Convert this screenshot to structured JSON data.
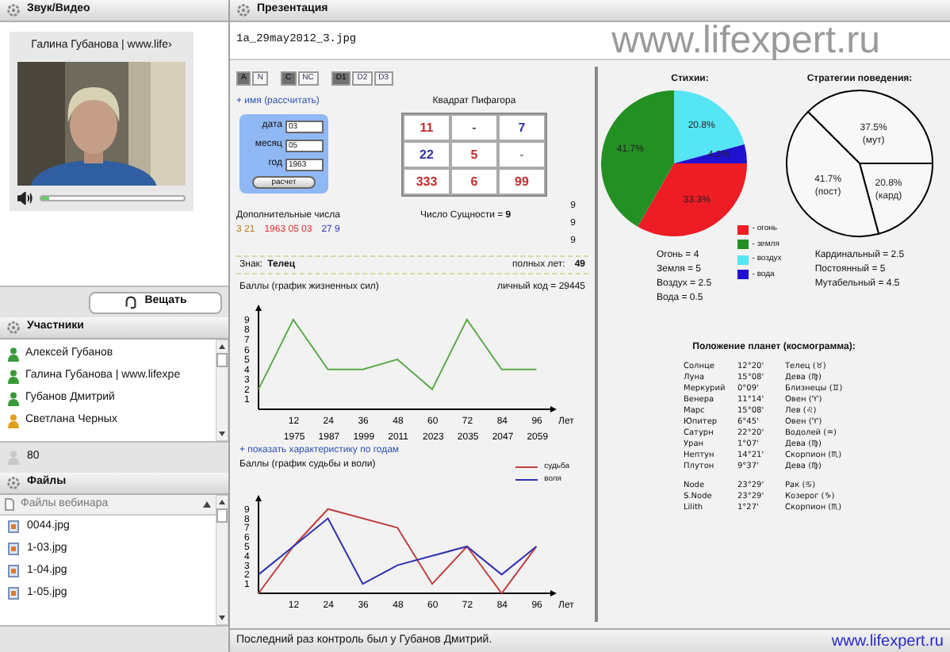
{
  "audio_video": {
    "title": "Звук/Видео",
    "speaker": "Галина Губанова | www.life›",
    "volume": {
      "level": 0.06
    },
    "broadcast_button": "Вещать"
  },
  "participants": {
    "title": "Участники",
    "items": [
      {
        "name": "Алексей Губанов",
        "color": "#3a9a3a"
      },
      {
        "name": "Галина Губанова | www.lifexpe",
        "color": "#3a9a3a"
      },
      {
        "name": "Губанов Дмитрий",
        "color": "#3a9a3a"
      },
      {
        "name": "Светлана Черных",
        "color": "#e0a020"
      }
    ],
    "count": "80"
  },
  "files": {
    "title": "Файлы",
    "column": "Файлы вебинара",
    "items": [
      "0044.jpg",
      "1-03.jpg",
      "1-04.jpg",
      "1-05.jpg"
    ]
  },
  "presentation": {
    "title": "Презентация",
    "filename": "1a_29may2012_3.jpg",
    "site_banner": "www.lifexpert.ru",
    "mode_groups": [
      [
        {
          "label": "A",
          "selected": true
        },
        {
          "label": "N",
          "selected": false
        }
      ],
      [
        {
          "label": "C",
          "selected": true
        },
        {
          "label": "NC",
          "selected": false
        }
      ],
      [
        {
          "label": "D1",
          "selected": true
        },
        {
          "label": "D2",
          "selected": false
        },
        {
          "label": "D3",
          "selected": false
        }
      ]
    ],
    "name_link": "+ имя (рассчитать)",
    "form": {
      "fields": [
        {
          "label": "дата",
          "value": "03"
        },
        {
          "label": "месяц",
          "value": "05"
        },
        {
          "label": "год",
          "value": "1963"
        }
      ],
      "button": "расчет"
    },
    "square": {
      "title": "Квадрат Пифагора",
      "cells": [
        {
          "text": "11",
          "color": "#c03030"
        },
        {
          "text": "-",
          "color": "#555555"
        },
        {
          "text": "7",
          "color": "#3030a0"
        },
        {
          "text": "22",
          "color": "#3030a0"
        },
        {
          "text": "5",
          "color": "#c03030"
        },
        {
          "text": "-",
          "color": "#888888"
        },
        {
          "text": "333",
          "color": "#c03030"
        },
        {
          "text": "6",
          "color": "#c03030"
        },
        {
          "text": "99",
          "color": "#c03030"
        }
      ]
    },
    "side_numbers": [
      "9",
      "9",
      "9"
    ],
    "extra": {
      "title": "Дополнительные числа",
      "numbers": [
        {
          "text": "3 21",
          "color": "#b08020"
        },
        {
          "text": "1963 05 03",
          "color": "#e03030"
        },
        {
          "text": "27 9",
          "color": "#3030c0"
        }
      ]
    },
    "essence": "Число Сущности = **9**",
    "sign_label": "Знак:",
    "sign": "Телец",
    "age_label": "полных лет:",
    "age": "49",
    "life_chart": {
      "title": "Баллы (график жизненных сил)",
      "code": "личный код = 29445",
      "years": [
        "1975",
        "1987",
        "1999",
        "2011",
        "2023",
        "2035",
        "2047",
        "2059"
      ],
      "chart_data": {
        "type": "line",
        "xlabel": "Лет",
        "x": [
          0,
          12,
          24,
          36,
          48,
          60,
          72,
          84,
          96
        ],
        "series": [
          {
            "color": "#5aaa4a",
            "values": [
              2,
              9,
              4,
              4,
              5,
              2,
              9,
              4,
              4
            ]
          }
        ],
        "xticks": [
          12,
          24,
          36,
          48,
          60,
          72,
          84,
          96
        ],
        "yticks": [
          1,
          2,
          3,
          4,
          5,
          6,
          7,
          8,
          9
        ],
        "xlim": [
          0,
          103
        ],
        "ylim": [
          0,
          10.5
        ]
      }
    },
    "years_link": "+ показать характеристику по годам",
    "fate_chart": {
      "title": "Баллы (график судьбы и воли)",
      "chart_data": {
        "type": "line",
        "xlabel": "Лет",
        "x": [
          0,
          12,
          24,
          36,
          48,
          60,
          72,
          84,
          96
        ],
        "series": [
          {
            "name": "судьба",
            "color": "#c04040",
            "values": [
              0,
              5,
              9,
              8,
              7,
              1,
              5,
              0,
              5
            ]
          },
          {
            "name": "воля",
            "color": "#3030b0",
            "values": [
              2,
              5,
              8,
              1,
              3,
              4,
              5,
              2,
              5
            ]
          }
        ],
        "xticks": [
          12,
          24,
          36,
          48,
          60,
          72,
          84,
          96
        ],
        "yticks": [
          1,
          2,
          3,
          4,
          5,
          6,
          7,
          8,
          9
        ],
        "xlim": [
          0,
          103
        ],
        "ylim": [
          0,
          10.5
        ]
      }
    },
    "elements": {
      "chart_data": {
        "type": "pie",
        "title": "Стихии:",
        "categories": [
          "- огонь",
          "- земля",
          "- воздух",
          "- вода"
        ],
        "colors": [
          "#ee1c24",
          "#239023",
          "#55e5f5",
          "#2010d0"
        ],
        "values": [
          33.3,
          41.7,
          20.8,
          4.2
        ],
        "value_labels": [
          "33.3%",
          "41.7%",
          "20.8%",
          "4.2%"
        ]
      },
      "totals": [
        "Огонь = 4",
        "Земля = 5",
        "Воздух = 2.5",
        "Вода = 0.5"
      ]
    },
    "strategies": {
      "chart_data": {
        "type": "pie",
        "title": "Стратегии поведения:",
        "categories": [
          "(мут)",
          "(кард)",
          "(пост)"
        ],
        "values": [
          37.5,
          20.8,
          41.7
        ],
        "value_labels": [
          "37.5%",
          "20.8%",
          "41.7%"
        ]
      },
      "totals": [
        "Кардинальный = 2.5",
        "Постоянный = 5",
        "Мутабельный = 4.5"
      ]
    },
    "planets": {
      "title": "Положение планет (космограмма):",
      "groups": [
        [
          [
            "Солнце",
            "12°20'",
            "Телец (♉)"
          ],
          [
            "Луна",
            "15°08'",
            "Дева (♍)"
          ],
          [
            "Меркурий",
            "0°09'",
            "Близнецы (♊)"
          ],
          [
            "Венера",
            "11°14'",
            "Овен (♈)"
          ],
          [
            "Марс",
            "15°08'",
            "Лев (♌)"
          ],
          [
            "Юпитер",
            "6°45'",
            "Овен (♈)"
          ],
          [
            "Сатурн",
            "22°20'",
            "Водолей (♒)"
          ],
          [
            "Уран",
            "1°07'",
            "Дева (♍)"
          ],
          [
            "Нептун",
            "14°21'",
            "Скорпион (♏)"
          ],
          [
            "Плутон",
            "9°37'",
            "Дева (♍)"
          ]
        ],
        [
          [
            "Node",
            "23°29'",
            "Рак (♋)"
          ],
          [
            "S.Node",
            "23°29'",
            "Козерог (♑)"
          ],
          [
            "Lilith",
            "1°27'",
            "Скорпион (♏)"
          ]
        ]
      ]
    },
    "footer": "Последний раз контроль был у Губанов Дмитрий.",
    "site_footer": "www.lifexpert.ru"
  }
}
